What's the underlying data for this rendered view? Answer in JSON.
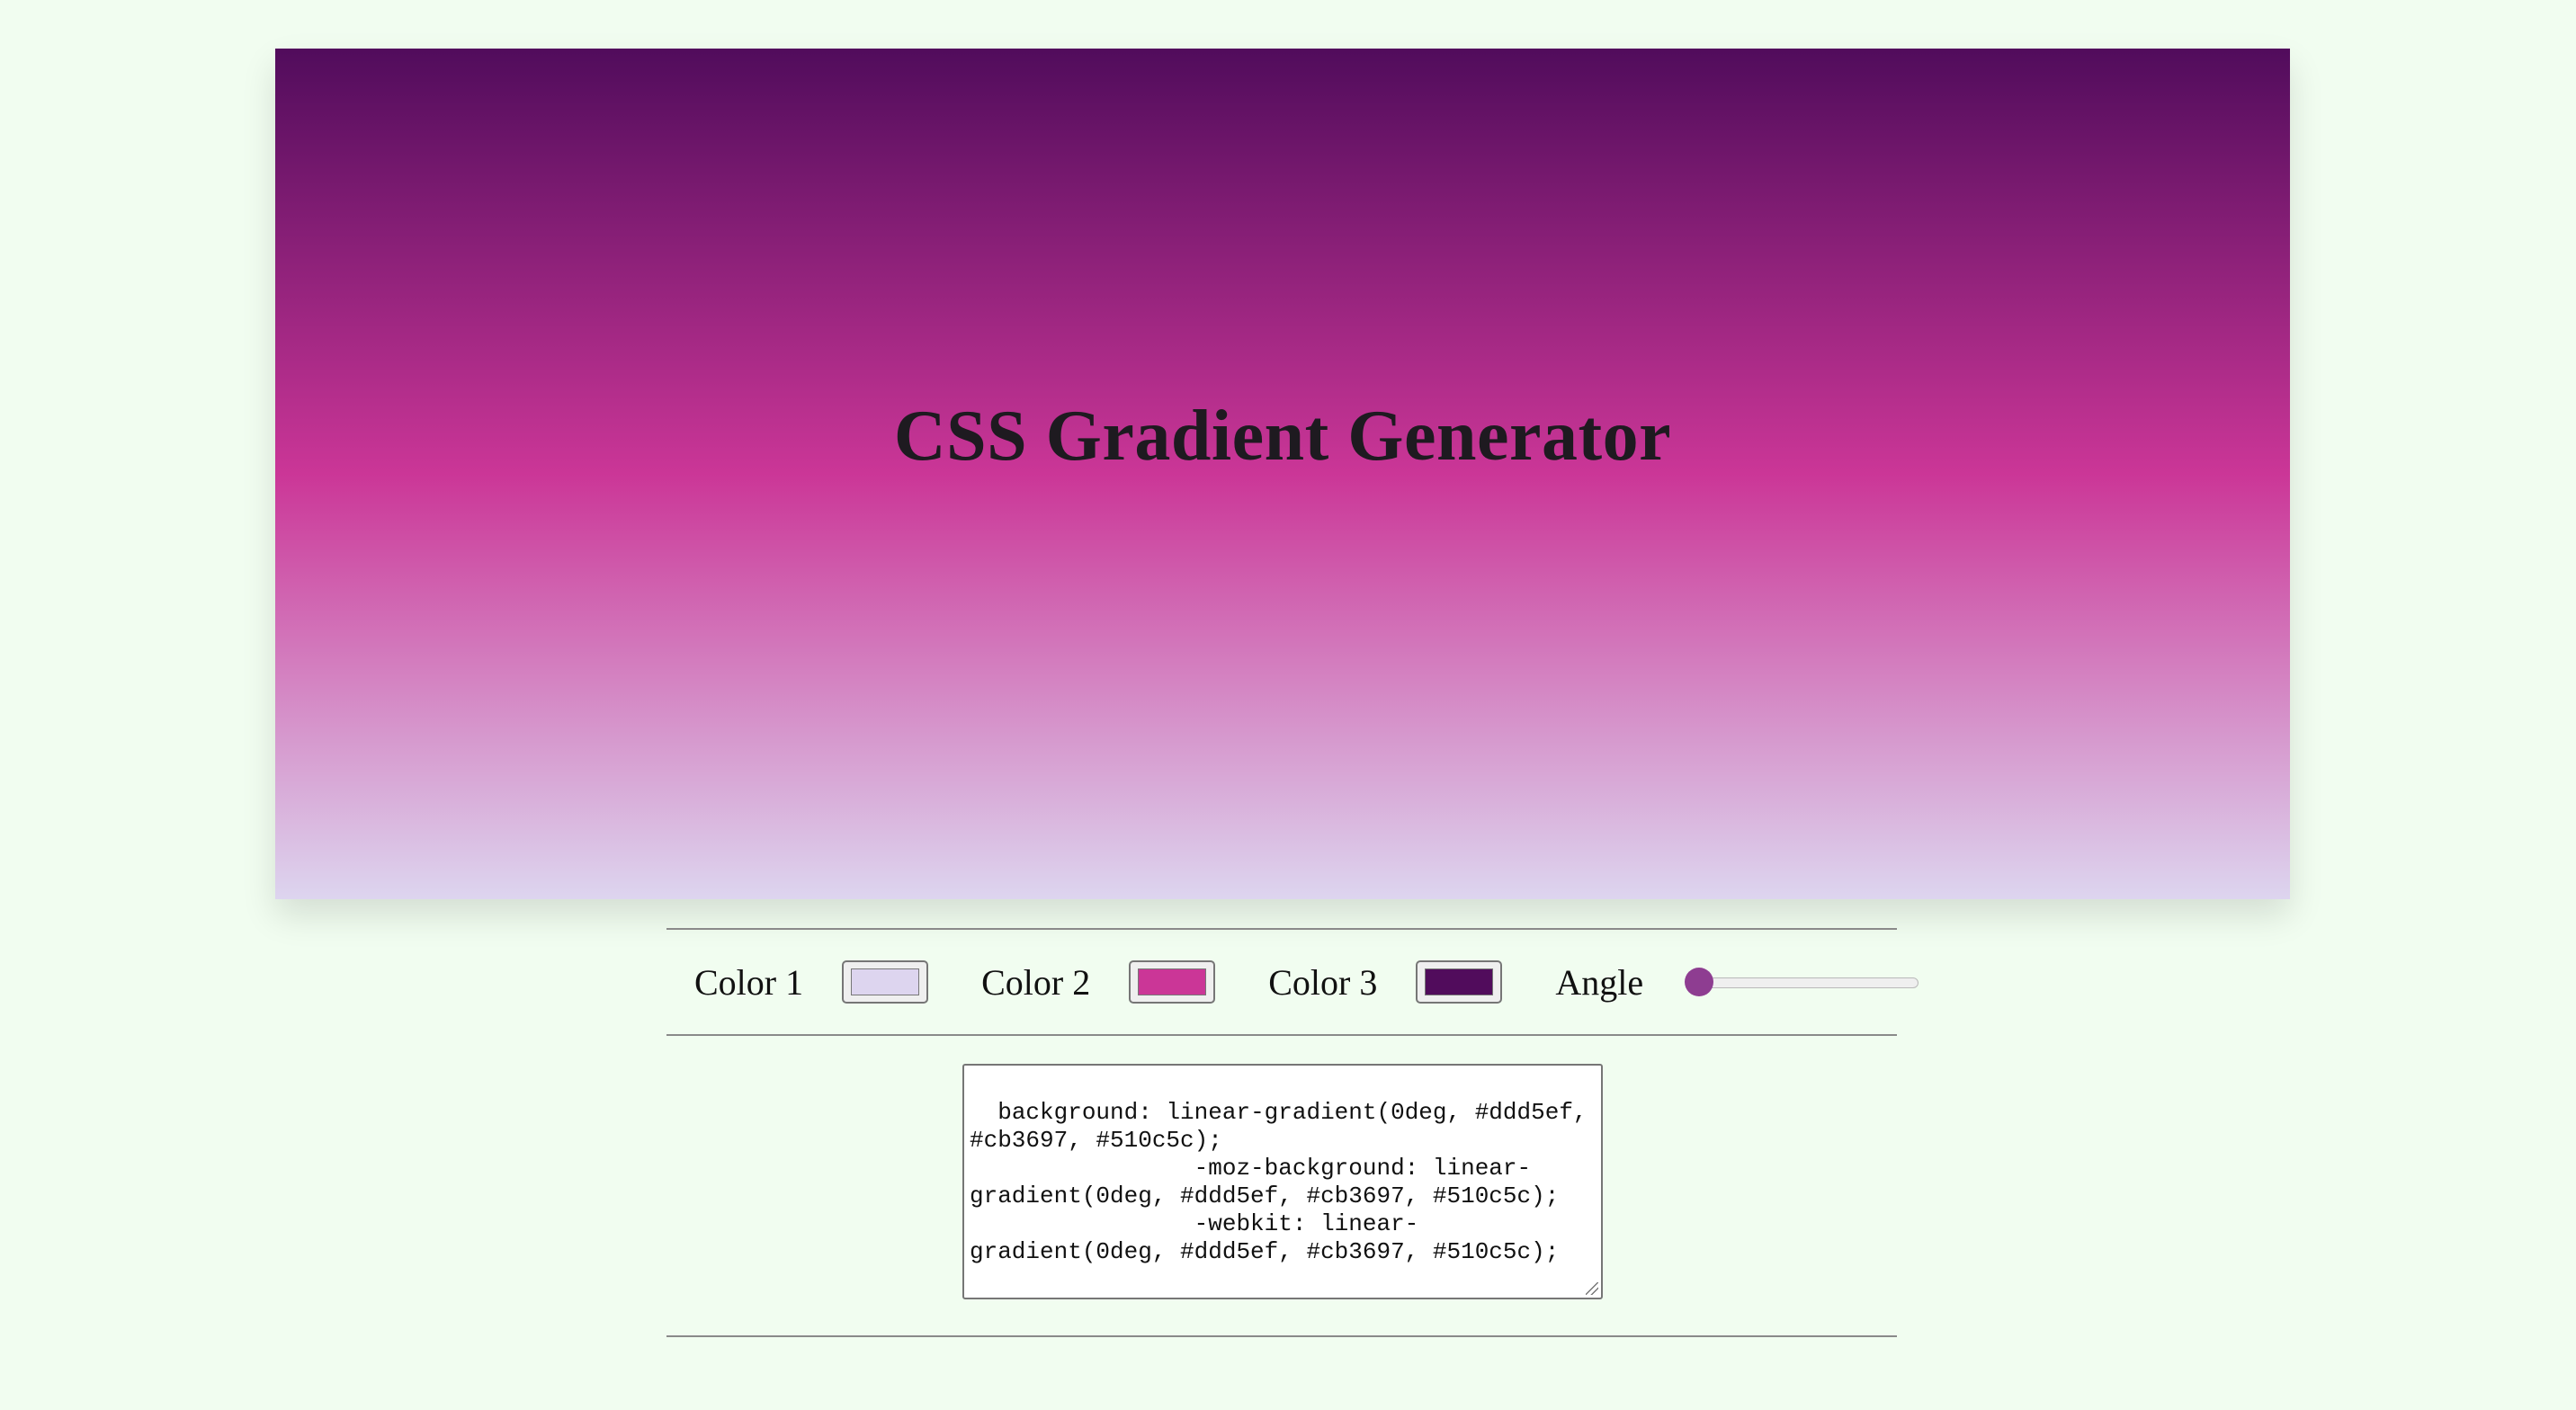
{
  "header": {
    "title": "CSS Gradient Generator"
  },
  "gradient": {
    "color1": "#ddd5ef",
    "color2": "#cb3697",
    "color3": "#510c5c",
    "angle_deg": 0
  },
  "controls": {
    "color1_label": "Color 1",
    "color2_label": "Color 2",
    "color3_label": "Color 3",
    "angle_label": "Angle",
    "angle_min": 0,
    "angle_max": 360
  },
  "output": {
    "css_text": "background: linear-gradient(0deg, #ddd5ef, #cb3697, #510c5c);\n                -moz-background: linear-gradient(0deg, #ddd5ef, #cb3697, #510c5c);\n                -webkit: linear-gradient(0deg, #ddd5ef, #cb3697, #510c5c);"
  },
  "colors": {
    "page_background": "#f1fdf0",
    "slider_thumb": "#8e3d91"
  }
}
